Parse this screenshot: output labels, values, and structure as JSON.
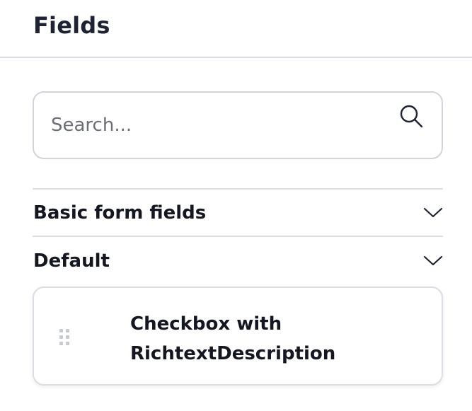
{
  "panel": {
    "title": "Fields"
  },
  "search": {
    "placeholder": "Search...",
    "icon": "search-icon"
  },
  "sections": [
    {
      "label": "Basic form fields",
      "icon": "chevron-down-icon",
      "expanded": false
    },
    {
      "label": "Default",
      "icon": "chevron-down-icon",
      "expanded": true
    }
  ],
  "default_fields": [
    {
      "label": "Checkbox with RichtextDescription",
      "icon": "drag-handle-icon"
    }
  ],
  "colors": {
    "text": "#1e2333",
    "border": "#dcdde2",
    "placeholder": "#6c6e78",
    "handle": "#c8cad1"
  }
}
